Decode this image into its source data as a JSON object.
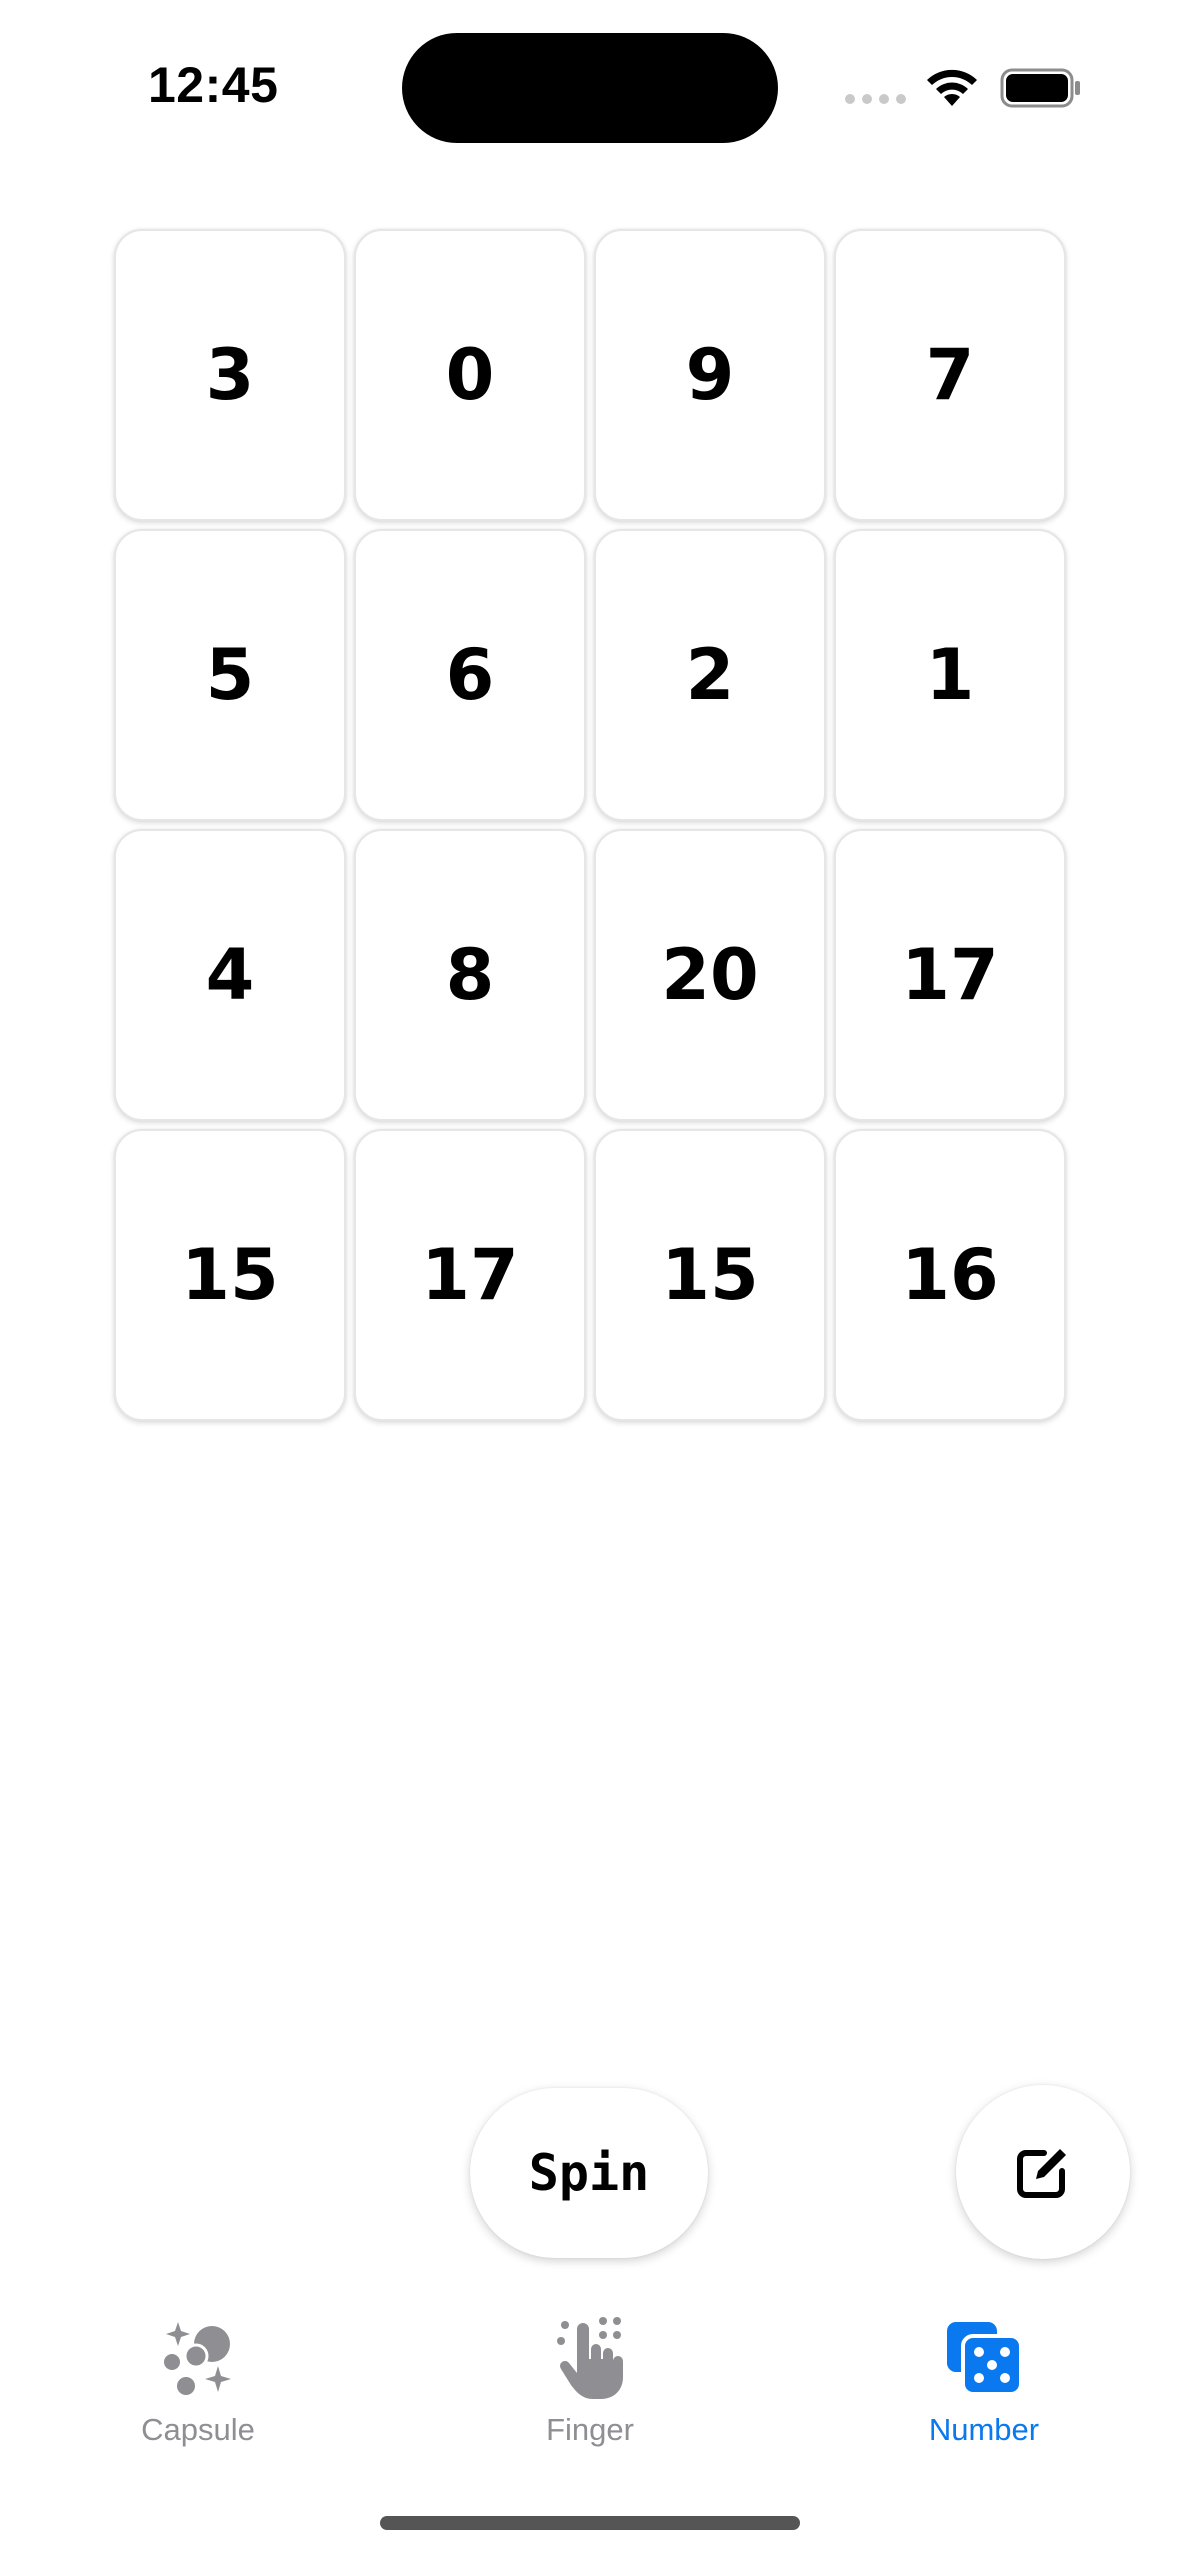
{
  "status_bar": {
    "time": "12:45"
  },
  "grid": {
    "rows": [
      [
        "3",
        "0",
        "9",
        "7"
      ],
      [
        "5",
        "6",
        "2",
        "1"
      ],
      [
        "4",
        "8",
        "20",
        "17"
      ],
      [
        "15",
        "17",
        "15",
        "16"
      ]
    ]
  },
  "actions": {
    "spin_label": "Spin"
  },
  "tabs": [
    {
      "label": "Capsule",
      "icon": "sparkles-bubbles-icon",
      "selected": false
    },
    {
      "label": "Finger",
      "icon": "hand-tap-icon",
      "selected": false
    },
    {
      "label": "Number",
      "icon": "dice-icon",
      "selected": true
    }
  ],
  "colors": {
    "accent": "#0a78ee",
    "inactive": "#8e8e93"
  }
}
